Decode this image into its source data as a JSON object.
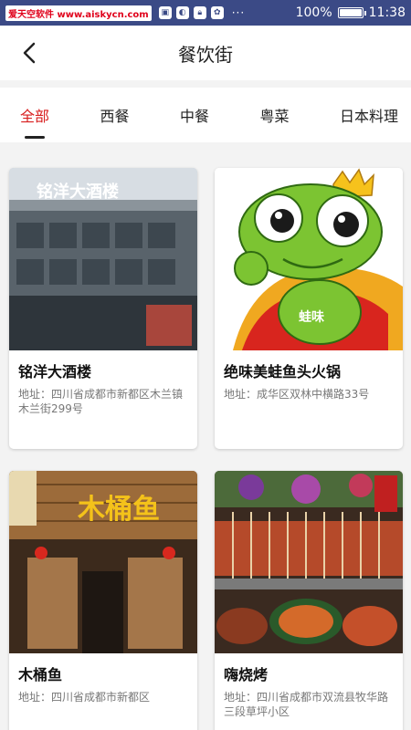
{
  "status_bar": {
    "watermark": "爱天空软件 www.aiskycn.com",
    "battery": "100%",
    "battery_level": 1.0,
    "time": "11:38"
  },
  "header": {
    "title": "餐饮街",
    "back_icon": "chevron-left-icon"
  },
  "tabs": [
    {
      "label": "全部",
      "active": true
    },
    {
      "label": "西餐",
      "active": false
    },
    {
      "label": "中餐",
      "active": false
    },
    {
      "label": "粤菜",
      "active": false
    },
    {
      "label": "日本料理",
      "active": false
    }
  ],
  "colors": {
    "active_tab": "#d81e1e",
    "status_bar": "#3b4a86"
  },
  "restaurants": [
    {
      "name": "铭洋大酒楼",
      "address": "地址：四川省成都市新都区木兰镇木兰街299号",
      "sign_text": "铭洋大酒楼"
    },
    {
      "name": "绝味美蛙鱼头火锅",
      "address": "地址：成华区双林中横路33号",
      "sign_text": "蛙味"
    },
    {
      "name": "木桶鱼",
      "address": "地址：四川省成都市新都区",
      "sign_text": "木桶鱼"
    },
    {
      "name": "嗨烧烤",
      "address": "地址：四川省成都市双流县牧华路三段草坪小区"
    }
  ]
}
